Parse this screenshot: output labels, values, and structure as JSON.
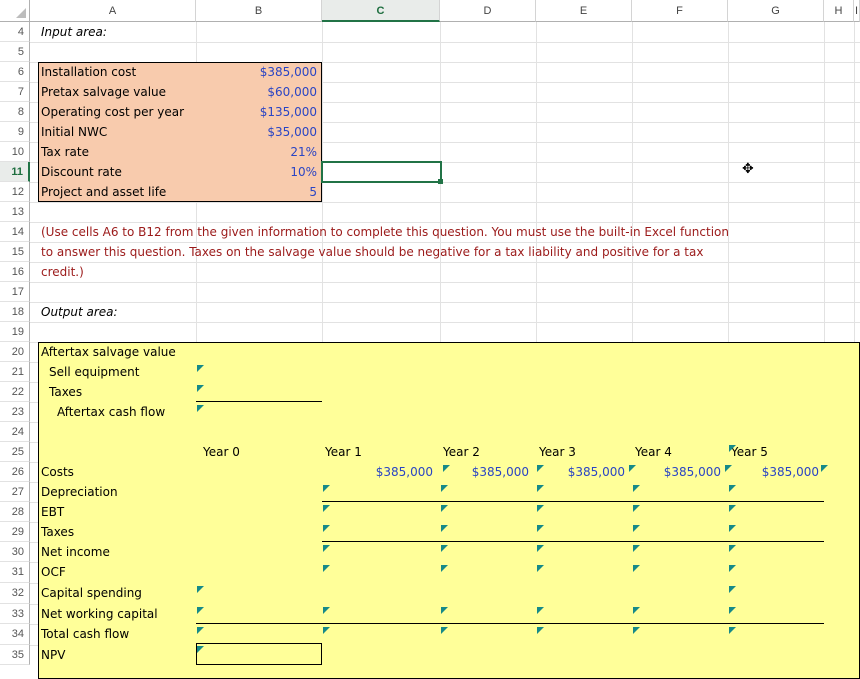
{
  "columns": [
    "A",
    "B",
    "C",
    "D",
    "E",
    "F",
    "G",
    "H",
    "I"
  ],
  "selected_column": "C",
  "rows": [
    "4",
    "5",
    "6",
    "7",
    "8",
    "9",
    "10",
    "11",
    "12",
    "13",
    "14",
    "15",
    "16",
    "17",
    "18",
    "19",
    "20",
    "21",
    "22",
    "23",
    "24",
    "25",
    "26",
    "27",
    "28",
    "29",
    "30",
    "31",
    "32",
    "33",
    "34",
    "35"
  ],
  "selected_row": "11",
  "input": {
    "title": "Input area:",
    "labels": [
      "Installation cost",
      "Pretax salvage value",
      "Operating cost per year",
      "Initial NWC",
      "Tax rate",
      "Discount rate",
      "Project and asset life"
    ],
    "values": [
      "$385,000",
      "$60,000",
      "$135,000",
      "$35,000",
      "21%",
      "10%",
      "5"
    ]
  },
  "instructions": [
    "(Use cells A6 to B12 from the given information to complete this question. You must use the built-in Excel function",
    "to answer this question. Taxes on the salvage value should be negative for a tax liability and positive for a tax",
    "credit.)"
  ],
  "output": {
    "title": "Output area:",
    "salvage_title": "Aftertax salvage value",
    "salvage_rows": [
      "Sell equipment",
      "Taxes",
      "Aftertax cash flow"
    ],
    "years": [
      "Year 0",
      "Year 1",
      "Year 2",
      "Year 3",
      "Year 4",
      "Year 5"
    ],
    "cost_value": "$385,000",
    "row_labels": [
      "Costs",
      "Depreciation",
      "EBT",
      "Taxes",
      "Net income",
      "OCF",
      "Capital spending",
      "Net working capital",
      "Total cash flow",
      "NPV"
    ]
  },
  "colors": {
    "input_fill": "#f8cbad",
    "output_fill": "#ffff99",
    "selection": "#217346",
    "comment_marker": "#168a88"
  }
}
